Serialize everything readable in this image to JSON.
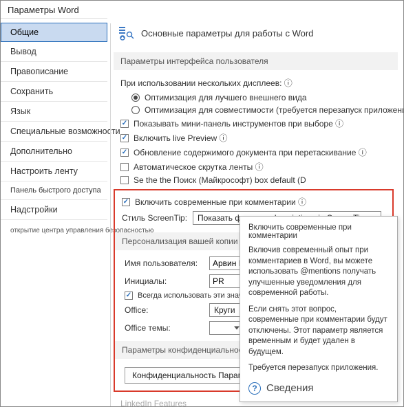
{
  "window": {
    "title": "Параметры Word"
  },
  "sidebar": {
    "items": [
      "Общие",
      "Вывод",
      "Правописание",
      "Сохранить",
      "Язык",
      "Специальные возможности",
      "Дополнительно",
      "Настроить ленту",
      "Панель быстрого доступа",
      "Надстройки"
    ],
    "footer": "открытие центра управления безопасностью"
  },
  "main": {
    "heading": "Основные параметры для работы с Word",
    "section1": {
      "title": "Параметры интерфейса пользователя",
      "multi_label": "При использовании нескольких дисплеев: ⓘ",
      "radio1": "Оптимизация для лучшего внешнего вида",
      "radio2": "Оптимизация для совместимости (требуется перезапуск приложения)",
      "chk1": "Показывать мини-панель инструментов при выборе ⓘ",
      "chk2": "Включить live Preview ⓘ",
      "chk3": "Обновление содержимого документа при перетаскивание ⓘ",
      "chk4": "Автоматическое скрутка ленты ⓘ",
      "chk5": "Se the the Поиск (Майкрософт) box default (D",
      "chk6": "Включить современные при комментарии ⓘ",
      "screentip_label": "Стиль ScreenTip:",
      "screentip_value": "Показать функцию descriptions in ScreenTips"
    },
    "section2": {
      "title": "Персонализация вашей копии Microsoft Office",
      "username_label": "Имя пользователя:",
      "username_value": "Арвин Pa d",
      "initials_label": "Инициалы:",
      "initials_value": "PR",
      "always_chk": "Всегда использовать эти значения",
      "office_label": "Office:",
      "office_value": "Круги",
      "theme_label": "Office темы:",
      "theme_value": ""
    },
    "section3": {
      "title": "Параметры конфиденциальности",
      "button": "Конфиденциальность Параметры..."
    },
    "linkedin": "LinkedIn Features"
  },
  "tooltip": {
    "title": "Включить современные при комментарии",
    "p1": "Включив современный опыт при комментариев в Word, вы можете использовать @mentions получать улучшенные уведомления для современной работы.",
    "p2": "Если снять этот вопрос, современные при комментарии будут отключены. Этот параметр является временным и будет удален в будущем.",
    "p3": "Требуется перезапуск приложения.",
    "footer": "Сведения"
  }
}
